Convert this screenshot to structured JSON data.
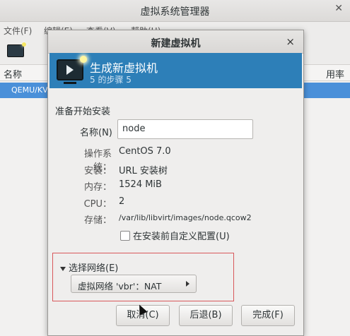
{
  "main_window": {
    "title": "虚拟系统管理器",
    "close_glyph": "✕",
    "menu": [
      "文件(F)",
      "编辑(E)",
      "查看(V)",
      "帮助(H)"
    ],
    "column_name": "名称",
    "column_rate": "用率",
    "row_label": "QEMU/KV"
  },
  "dialog": {
    "title": "新建虚拟机",
    "close_glyph": "×",
    "header_title": "生成新虚拟机",
    "header_step": "5 的步骤 5",
    "section": "准备开始安装",
    "name_label": "名称(N)",
    "name_value": "node",
    "details": [
      {
        "label": "操作系统：",
        "value": "CentOS 7.0"
      },
      {
        "label": "安装：",
        "value": "URL 安装树"
      },
      {
        "label": "内存：",
        "value": "1524 MiB"
      },
      {
        "label": "CPU：",
        "value": "2"
      },
      {
        "label": "存储：",
        "value": "/var/lib/libvirt/images/node.qcow2"
      }
    ],
    "customize_checkbox": "在安装前自定义配置(U)",
    "network_expander": "选择网络(E)",
    "network_value": "虚拟网络 'vbr'：NAT",
    "buttons": {
      "cancel": "取消(C)",
      "back": "后退(B)",
      "finish": "完成(F)"
    }
  },
  "colors": {
    "banner": "#2d7fb8",
    "selection": "#4a90d9",
    "highlight_frame": "#d8585b"
  }
}
